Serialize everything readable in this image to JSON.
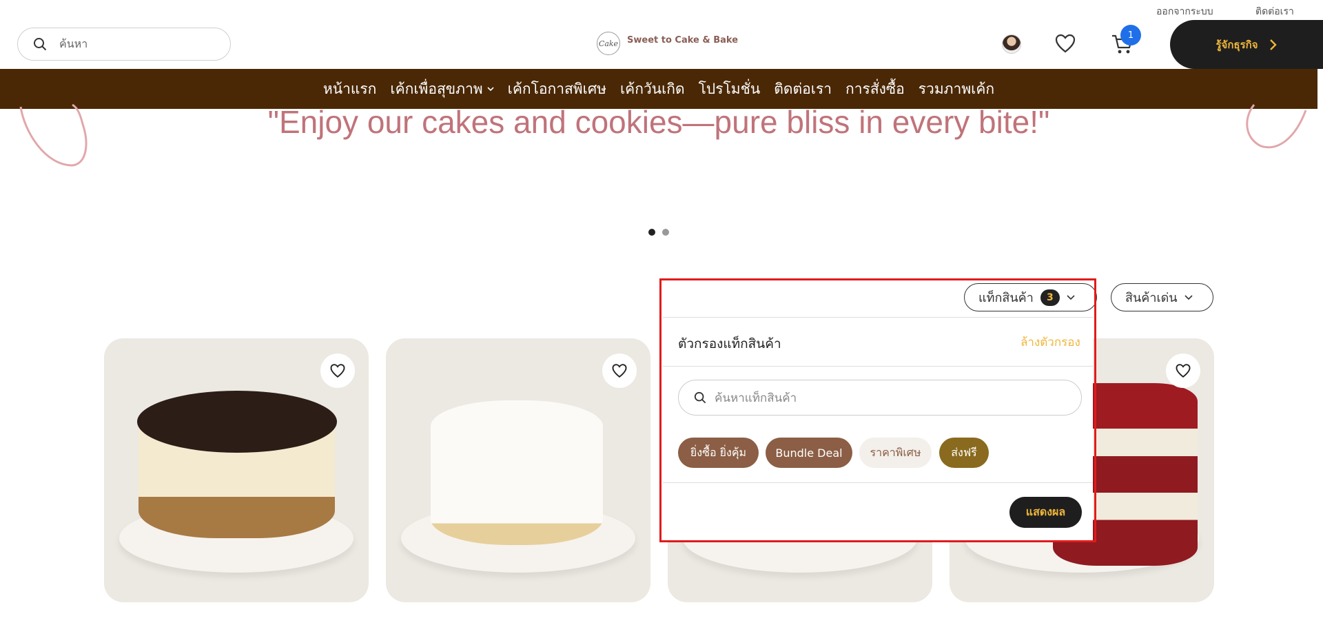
{
  "utility_links": {
    "logout": "ออกจากระบบ",
    "contact": "ติดต่อเรา"
  },
  "header": {
    "search_placeholder": "ค้นหา",
    "brand_name": "Sweet to Cake & Bake",
    "brand_mark": "Cake",
    "cart_count": "1",
    "about_button": "รู้จักธุรกิจ"
  },
  "nav": {
    "items": [
      "หน้าแรก",
      "เค้กเพื่อสุขภาพ",
      "เค้กโอกาสพิเศษ",
      "เค้กวันเกิด",
      "โปรโมชั่น",
      "ติดต่อเรา",
      "การสั่งซื้อ",
      "รวมภาพเค้ก"
    ]
  },
  "hero": {
    "quote": "\"Enjoy our cakes and cookies—pure bliss in every bite!\"",
    "slide_count": 2,
    "active_slide": 1
  },
  "filters": {
    "tags_label": "แท็กสินค้า",
    "tags_count": "3",
    "sort_label": "สินค้าเด่น"
  },
  "tag_panel": {
    "title": "ตัวกรองแท็กสินค้า",
    "clear_label": "ล้างตัวกรอง",
    "search_placeholder": "ค้นหาแท็กสินค้า",
    "chips": [
      "ยิ่งซื้อ ยิ่งคุ้ม",
      "Bundle Deal",
      "ราคาพิเศษ",
      "ส่งฟรี"
    ],
    "apply_label": "แสดงผล"
  },
  "colors": {
    "nav_bg": "#4a2806",
    "accent": "#f0b63c",
    "quote": "#c0737a",
    "chip_brown": "#8b5e45",
    "chip_light": "#f3efea",
    "chip_gold": "#8a6a1e",
    "highlight_outline": "#e01b1b"
  }
}
